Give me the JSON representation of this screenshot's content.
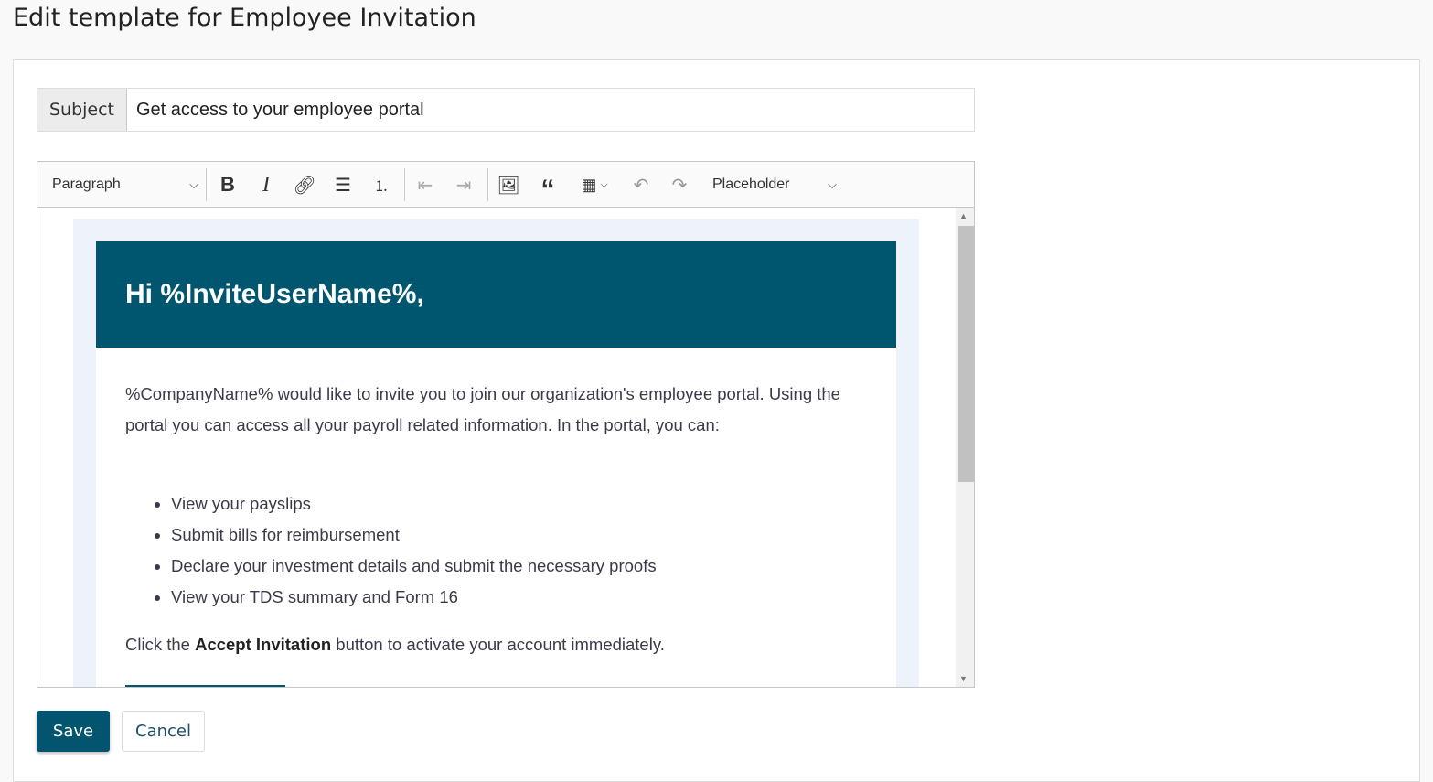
{
  "page": {
    "title": "Edit template for Employee Invitation"
  },
  "subject": {
    "label": "Subject",
    "value": "Get access to your employee portal"
  },
  "toolbar": {
    "heading": "Paragraph",
    "placeholder": "Placeholder"
  },
  "email": {
    "greeting": "Hi %InviteUserName%,",
    "intro": "%CompanyName% would like to invite you to join our organization's employee portal. Using the portal you can access all your payroll related information. In the portal, you can:",
    "items": [
      "View your payslips",
      "Submit bills for reimbursement",
      "Declare your investment details and submit the necessary proofs",
      "View your TDS summary and Form 16"
    ],
    "cta_pre": "Click the ",
    "cta_bold": "Accept Invitation",
    "cta_post": " button to activate your account immediately."
  },
  "actions": {
    "save": "Save",
    "cancel": "Cancel"
  },
  "colors": {
    "brand": "#01566f"
  }
}
